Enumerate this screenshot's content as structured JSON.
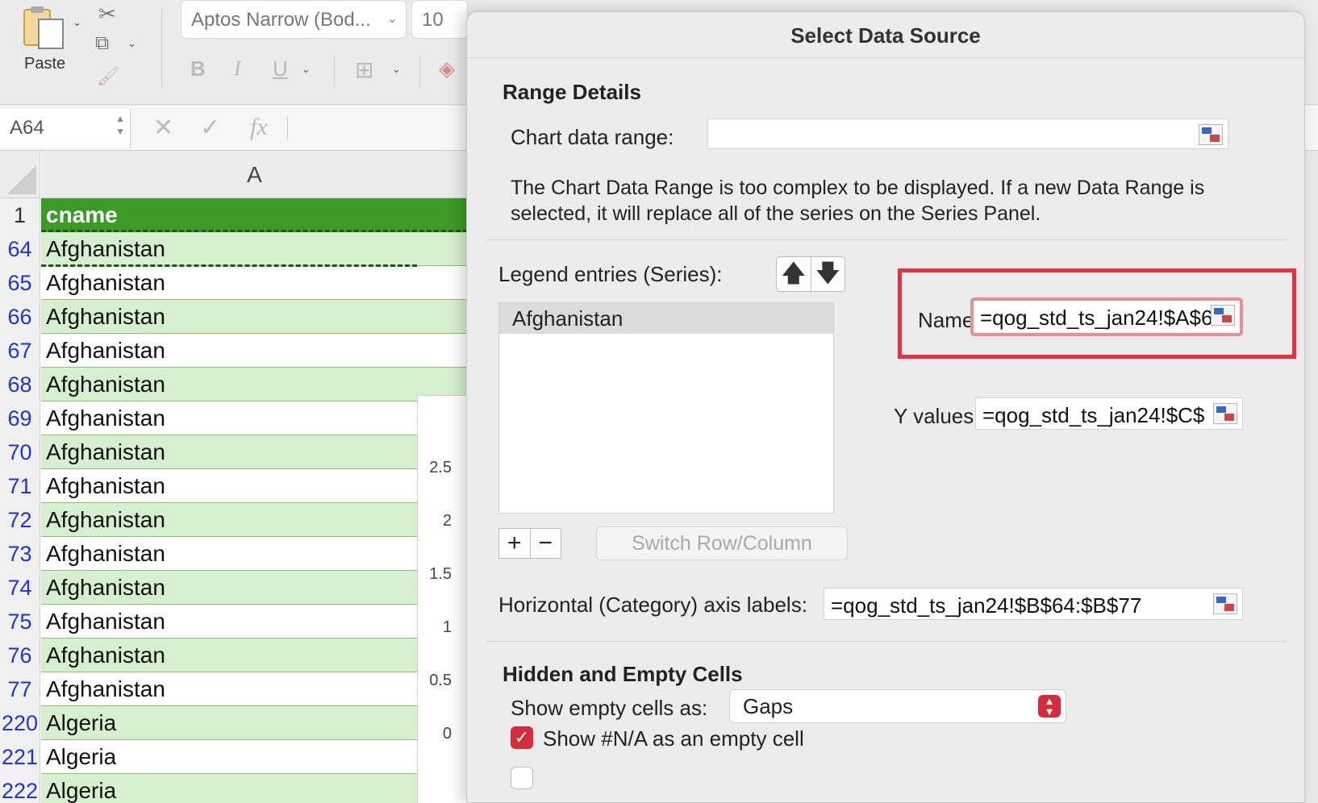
{
  "ribbon": {
    "paste_label": "Paste",
    "font_name": "Aptos Narrow (Bod...",
    "font_size": "10",
    "bold": "B",
    "italic": "I",
    "underline": "U"
  },
  "formula_bar": {
    "name_box": "A64",
    "cancel": "✕",
    "confirm": "✓",
    "fx": "fx"
  },
  "grid": {
    "column_header": "A",
    "header_row": {
      "num": "1",
      "value": "cname"
    },
    "rows": [
      {
        "num": "64",
        "value": "Afghanistan"
      },
      {
        "num": "65",
        "value": "Afghanistan"
      },
      {
        "num": "66",
        "value": "Afghanistan"
      },
      {
        "num": "67",
        "value": "Afghanistan"
      },
      {
        "num": "68",
        "value": "Afghanistan"
      },
      {
        "num": "69",
        "value": "Afghanistan"
      },
      {
        "num": "70",
        "value": "Afghanistan"
      },
      {
        "num": "71",
        "value": "Afghanistan"
      },
      {
        "num": "72",
        "value": "Afghanistan"
      },
      {
        "num": "73",
        "value": "Afghanistan"
      },
      {
        "num": "74",
        "value": "Afghanistan"
      },
      {
        "num": "75",
        "value": "Afghanistan"
      },
      {
        "num": "76",
        "value": "Afghanistan"
      },
      {
        "num": "77",
        "value": "Afghanistan"
      },
      {
        "num": "220",
        "value": "Algeria"
      },
      {
        "num": "221",
        "value": "Algeria"
      },
      {
        "num": "222",
        "value": "Algeria"
      }
    ],
    "chart_yticks": [
      "2.5",
      "2",
      "1.5",
      "1",
      "0.5",
      "0"
    ]
  },
  "dialog": {
    "title": "Select Data Source",
    "range_details_title": "Range Details",
    "chart_data_range_label": "Chart data range:",
    "chart_data_range_value": "",
    "description": "The Chart Data Range is too complex to be displayed. If a new Data Range is selected, it will replace all of the series on the Series Panel.",
    "legend_label": "Legend entries (Series):",
    "move_up": "🡅",
    "move_down": "🡇",
    "series": [
      "Afghanistan"
    ],
    "add": "+",
    "remove": "−",
    "switch_label": "Switch Row/Column",
    "name_label": "Name:",
    "name_value": "=qog_std_ts_jan24!$A$6",
    "y_values_label": "Y values:",
    "y_values_value": "=qog_std_ts_jan24!$C$",
    "category_label": "Horizontal (Category) axis labels:",
    "category_value": "=qog_std_ts_jan24!$B$64:$B$77",
    "hidden_title": "Hidden and Empty Cells",
    "show_empty_label": "Show empty cells as:",
    "show_empty_value": "Gaps",
    "show_na_label": "Show #N/A as an empty cell",
    "show_na_checked": true
  },
  "colors": {
    "accent": "#d52b3a",
    "highlight": "#e8303f",
    "header_green": "#3c9a26",
    "row_green": "#d6efcf",
    "row_number_blue": "#2033d6"
  }
}
